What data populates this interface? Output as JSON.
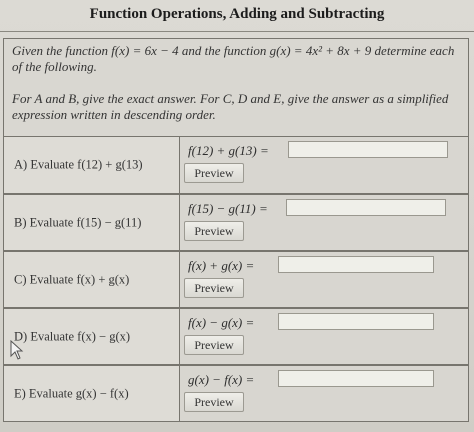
{
  "page": {
    "title": "Function Operations, Adding and Subtracting"
  },
  "intro": {
    "given": "Given the function f(x) = 6x − 4 and the function g(x) = 4x² + 8x + 9 determine each of the following.",
    "instructions": "For A and B, give the exact answer. For C, D and E, give the answer as a simplified expression written in descending order."
  },
  "problems": [
    {
      "label": "A) Evaluate f(12) + g(13)",
      "expression": "f(12) + g(13) =",
      "answer": "",
      "preview": "Preview"
    },
    {
      "label": "B) Evaluate f(15) − g(11)",
      "expression": "f(15) − g(11) =",
      "answer": "",
      "preview": "Preview"
    },
    {
      "label": "C) Evaluate f(x) + g(x)",
      "expression": "f(x) + g(x) =",
      "answer": "",
      "preview": "Preview"
    },
    {
      "label": "D) Evaluate f(x) − g(x)",
      "expression": "f(x) − g(x) =",
      "answer": "",
      "preview": "Preview"
    },
    {
      "label": "E) Evaluate g(x) − f(x)",
      "expression": "g(x) − f(x) =",
      "answer": "",
      "preview": "Preview"
    }
  ]
}
